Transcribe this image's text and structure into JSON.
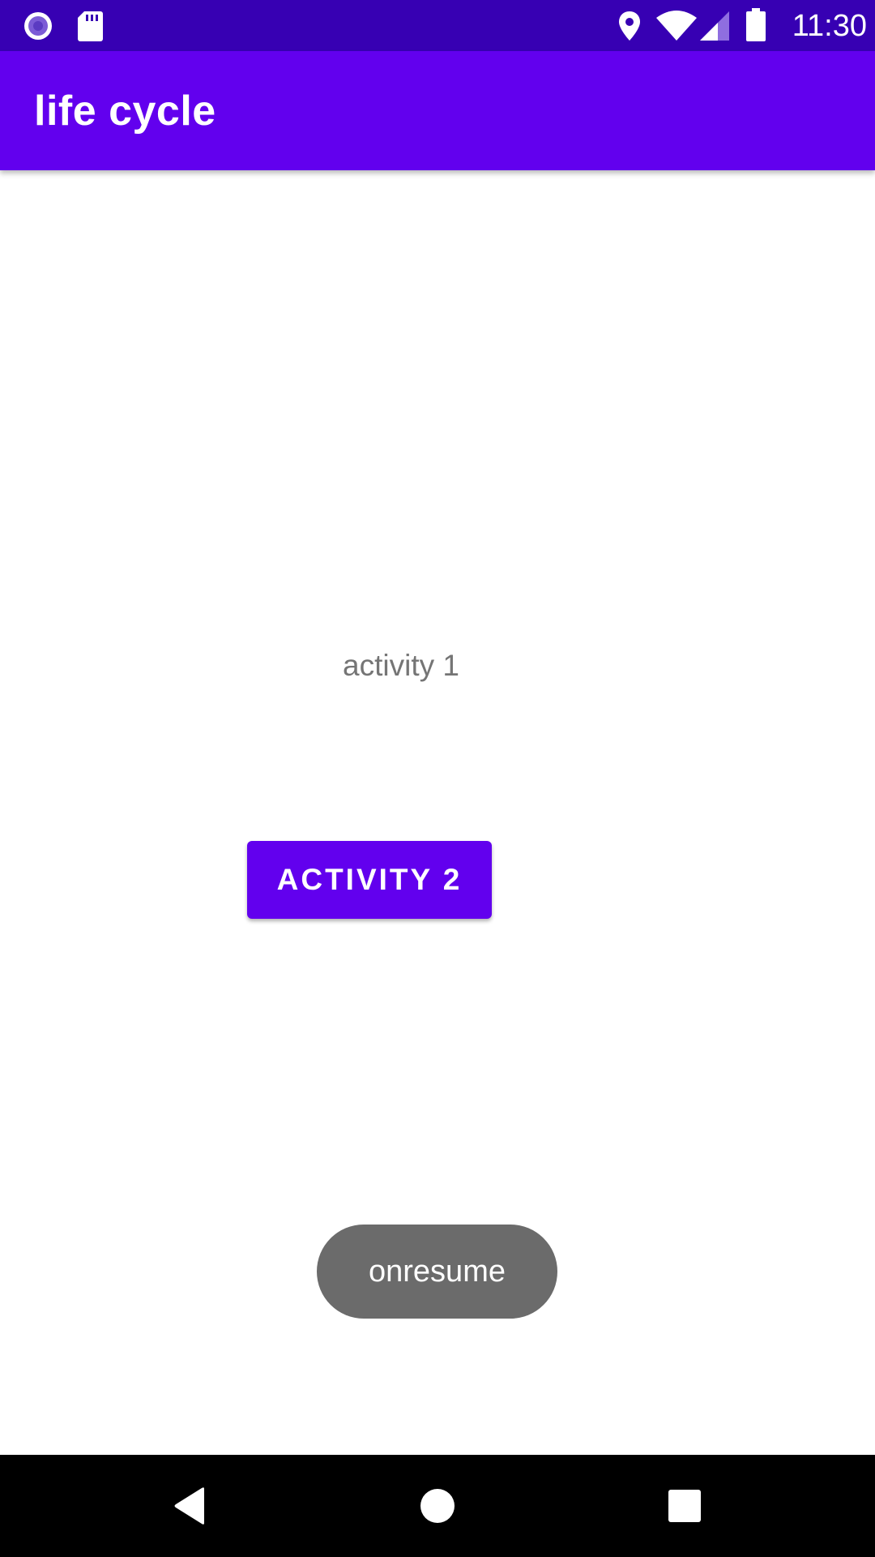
{
  "status_bar": {
    "time": "11:30",
    "icons": [
      "notification-circle-icon",
      "sd-card-icon",
      "location-icon",
      "wifi-icon",
      "signal-icon",
      "battery-icon"
    ],
    "background": "#3700B3"
  },
  "app_bar": {
    "title": "life cycle",
    "background": "#6200EE"
  },
  "content": {
    "activity_label": "activity 1",
    "button_label": "ACTIVITY 2",
    "button_color": "#6200EE"
  },
  "toast": {
    "message": "onresume"
  },
  "nav_bar": {
    "icons": [
      "back-icon",
      "home-icon",
      "recents-icon"
    ]
  }
}
